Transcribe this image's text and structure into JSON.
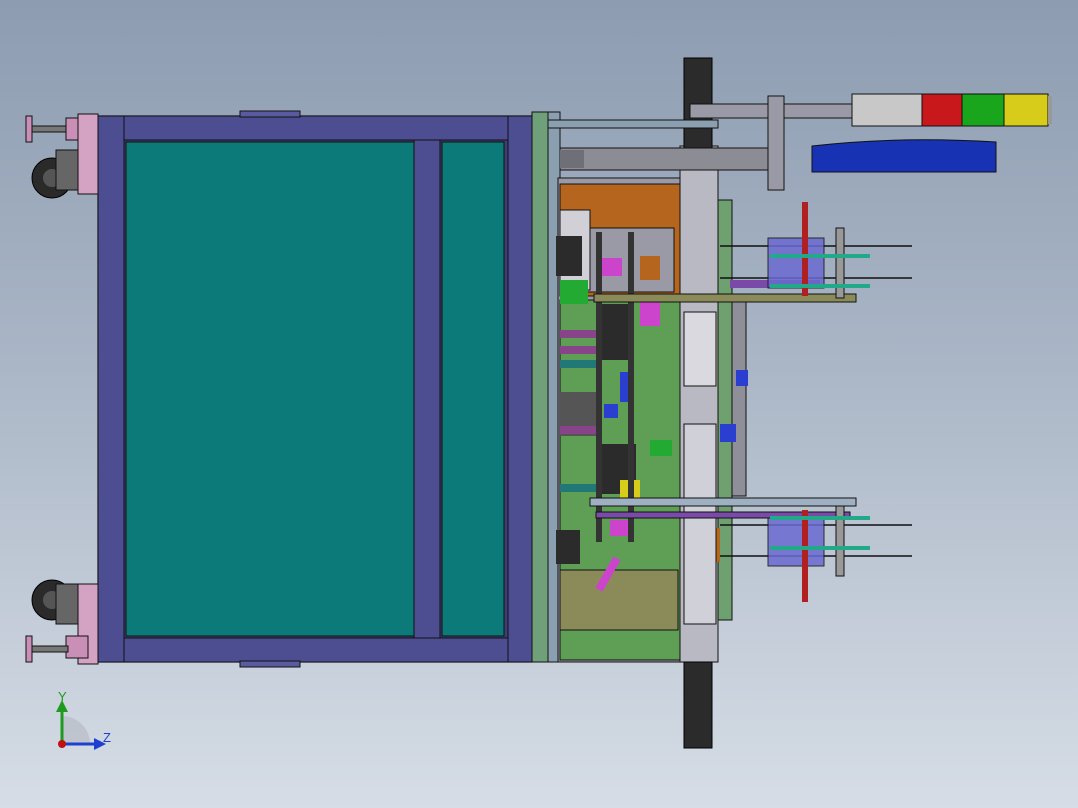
{
  "view": {
    "triad": {
      "y_label": "Y",
      "z_label": "Z"
    },
    "colors": {
      "frame": "#4a4a8c",
      "panel": "#0b7a78",
      "plate": "#9a9aa6",
      "plate_green": "#5f9e55",
      "bracket_brown": "#b5651d",
      "wheel": "#2a2a2a",
      "foot": "#c98fb6",
      "signal_red": "#c8181b",
      "signal_green": "#19a51c",
      "signal_yellow": "#d8cc1a",
      "blue_guard": "#1733b3",
      "axis_y": "#1f9a1f",
      "axis_z": "#1f3fcf",
      "axis_origin": "#c01010"
    }
  }
}
